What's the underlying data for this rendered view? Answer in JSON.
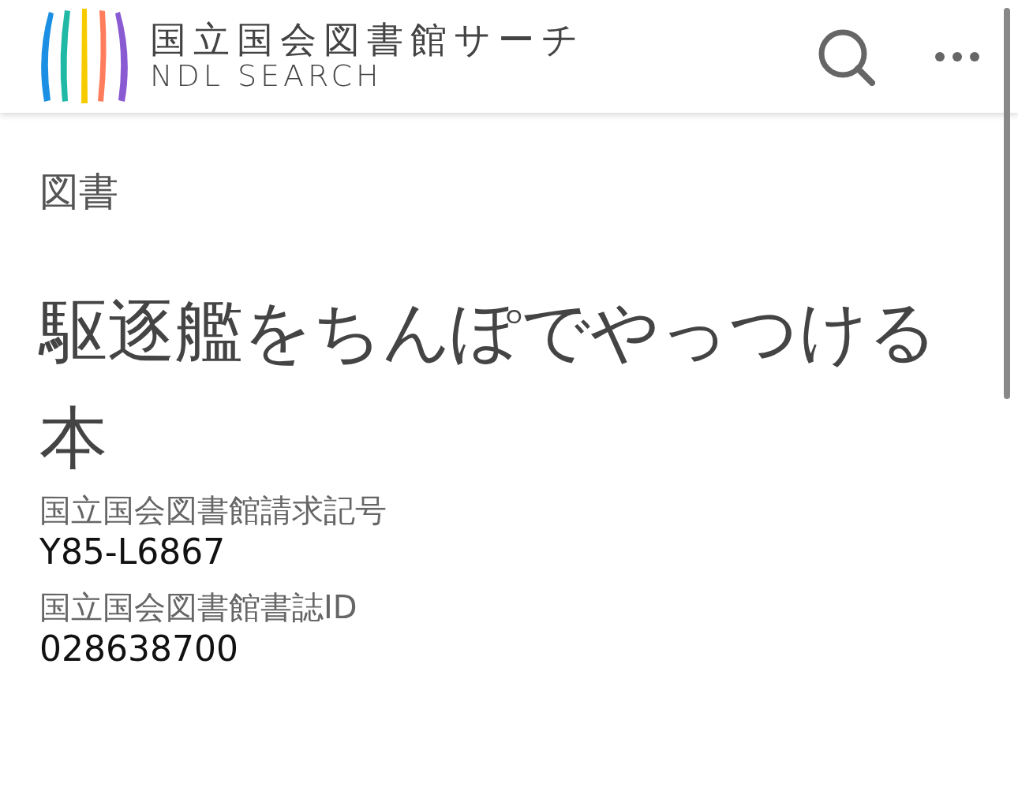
{
  "header": {
    "title": "国立国会図書館サーチ",
    "subtitle": "NDL SEARCH"
  },
  "item": {
    "type": "図書",
    "title": "駆逐艦をちんぽでやっつける本",
    "fields": [
      {
        "label": "国立国会図書館請求記号",
        "value": "Y85-L6867"
      },
      {
        "label": "国立国会図書館書誌ID",
        "value": "028638700"
      }
    ]
  }
}
